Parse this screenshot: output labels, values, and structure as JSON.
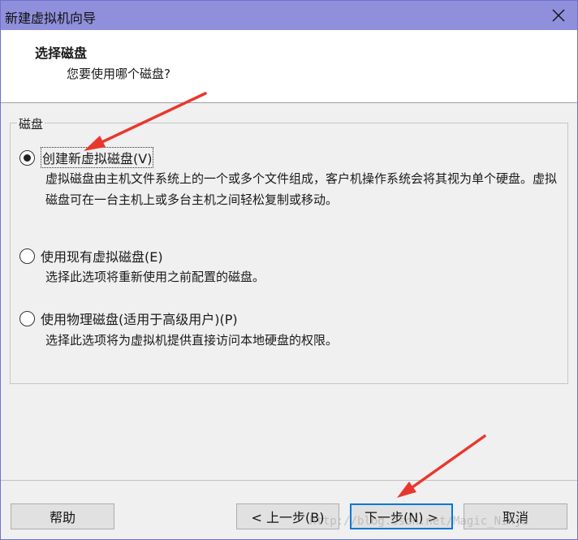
{
  "window": {
    "title": "新建虚拟机向导",
    "close_icon": "close-icon"
  },
  "header": {
    "title": "选择磁盘",
    "subtitle": "您要使用哪个磁盘?"
  },
  "group": {
    "label": "磁盘",
    "options": [
      {
        "label": "创建新虚拟磁盘(V)",
        "description": "虚拟磁盘由主机文件系统上的一个或多个文件组成，客户机操作系统会将其视为单个硬盘。虚拟磁盘可在一台主机上或多台主机之间轻松复制或移动。",
        "selected": true
      },
      {
        "label": "使用现有虚拟磁盘(E)",
        "description": "选择此选项将重新使用之前配置的磁盘。",
        "selected": false
      },
      {
        "label": "使用物理磁盘(适用于高级用户)(P)",
        "description": "选择此选项将为虚拟机提供直接访问本地硬盘的权限。",
        "selected": false
      }
    ]
  },
  "buttons": {
    "help": "帮助",
    "back": "< 上一步(B)",
    "next": "下一步(N) >",
    "cancel": "取消"
  },
  "watermark": "http://blog.csdn.net/Magic_Ninja",
  "colors": {
    "titlebar": "#8f8fdc",
    "annotation_arrow": "#e8382e",
    "default_button_border": "#0078d7"
  }
}
